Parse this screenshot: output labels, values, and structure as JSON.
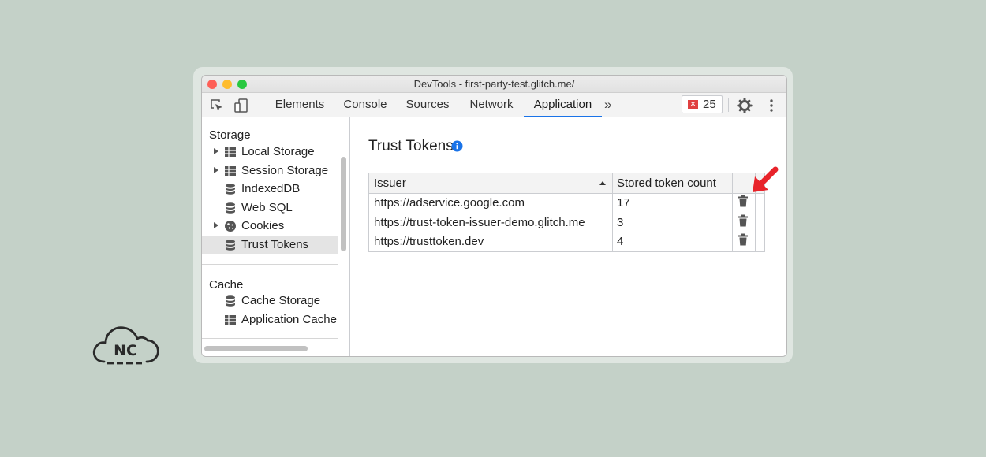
{
  "window": {
    "title": "DevTools - first-party-test.glitch.me/"
  },
  "toolbar": {
    "tabs": [
      {
        "label": "Elements"
      },
      {
        "label": "Console"
      },
      {
        "label": "Sources"
      },
      {
        "label": "Network"
      },
      {
        "label": "Application"
      }
    ],
    "active_tab": "Application",
    "issues_count": "25"
  },
  "sidebar": {
    "storage_title": "Storage",
    "storage_items": [
      {
        "label": "Local Storage",
        "icon": "table-icon",
        "expandable": true
      },
      {
        "label": "Session Storage",
        "icon": "table-icon",
        "expandable": true
      },
      {
        "label": "IndexedDB",
        "icon": "database-icon",
        "expandable": false
      },
      {
        "label": "Web SQL",
        "icon": "database-icon",
        "expandable": false
      },
      {
        "label": "Cookies",
        "icon": "cookie-icon",
        "expandable": true
      },
      {
        "label": "Trust Tokens",
        "icon": "database-icon",
        "expandable": false,
        "selected": true
      }
    ],
    "cache_title": "Cache",
    "cache_items": [
      {
        "label": "Cache Storage",
        "icon": "database-icon"
      },
      {
        "label": "Application Cache",
        "icon": "table-icon"
      }
    ]
  },
  "main": {
    "title": "Trust Tokens",
    "table": {
      "columns": [
        "Issuer",
        "Stored token count"
      ],
      "rows": [
        {
          "issuer": "https://adservice.google.com",
          "count": "17"
        },
        {
          "issuer": "https://trust-token-issuer-demo.glitch.me",
          "count": "3"
        },
        {
          "issuer": "https://trusttoken.dev",
          "count": "4"
        }
      ]
    }
  },
  "colors": {
    "background": "#c4d1c8",
    "accent": "#1a73e8",
    "annotation_arrow": "#e8232a",
    "issues_badge": "#e04040"
  }
}
